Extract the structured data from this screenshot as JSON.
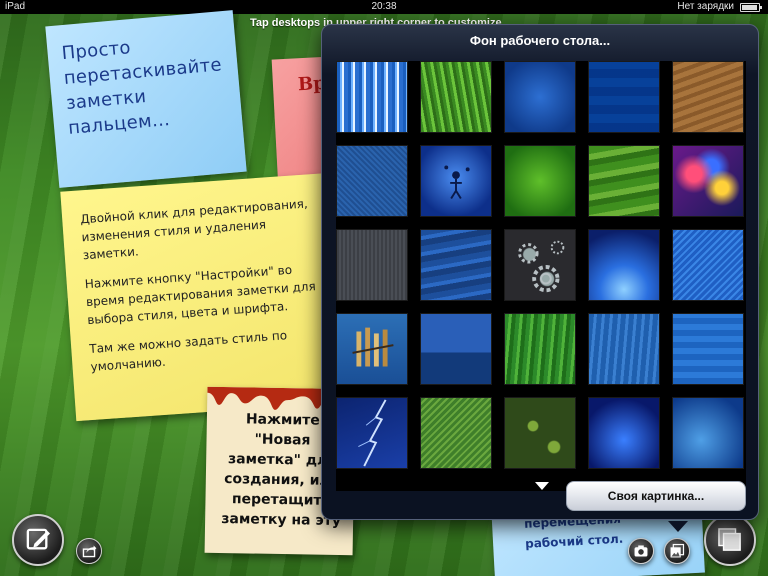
{
  "status_bar": {
    "carrier": "iPad",
    "time": "20:38",
    "battery_text": "Нет зарядки"
  },
  "hint_text": "Tap desktops in upper right corner to customize",
  "notes": {
    "blue_note": "Просто перетаскивайте заметки пальцем...",
    "pink_note": "Вр",
    "yellow_note": {
      "p1": "Двойной клик для редактирования, изменения стиля и удаления заметки.",
      "p2": "Нажмите кнопку \"Настройки\" во время редактирования заметки для выбора стиля, цвета и шрифта.",
      "p3": "Там же можно задать стиль по умолчанию."
    },
    "paper_note": "Нажмите\n\"Новая\nзаметка\" для\nсоздания, или\nперетащите\nзаметку на эту",
    "bottom_note": {
      "line1": "перемещения",
      "line2": "рабочий стол."
    }
  },
  "popover": {
    "title": "Фон рабочего стола...",
    "custom_button_label": "Своя картинка...",
    "wallpapers": [
      "blue-streaks",
      "green-grass",
      "blue-texture",
      "blue-squares",
      "wood-grain",
      "blue-dots",
      "blue-figure",
      "green-glow",
      "green-waves",
      "rainbow-bokeh",
      "gray-metal",
      "blue-waves",
      "gears",
      "blue-burst",
      "blue-diagonal",
      "pencils",
      "ocean-horizon",
      "green-blades",
      "blue-panes",
      "blue-pattern",
      "lightning",
      "green-weave",
      "green-paisley",
      "blue-stars",
      "blue-abstract"
    ]
  },
  "icons": {
    "new_note": "compose-icon",
    "share": "share-icon",
    "camera": "camera-icon",
    "photo": "photo-icon",
    "layers": "layers-icon"
  }
}
